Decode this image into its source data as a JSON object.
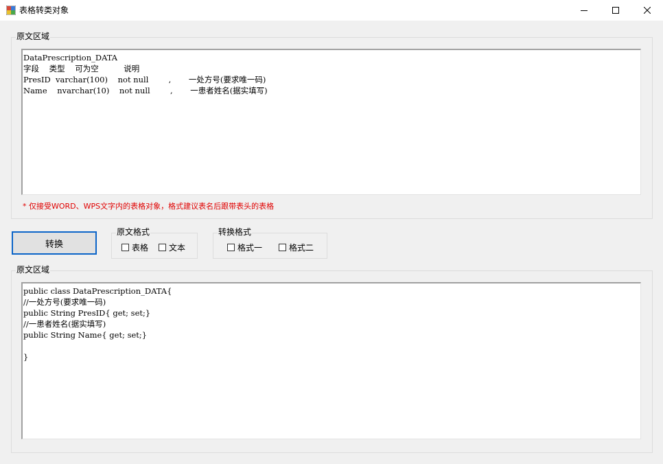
{
  "window": {
    "title": "表格转类对象",
    "minimize_icon": "minimize-icon",
    "maximize_icon": "maximize-icon",
    "close_icon": "close-icon"
  },
  "source_group": {
    "label": "原文区域",
    "text": "DataPrescription_DATA\n字段    类型    可为空          说明\nPresID  varchar(100)    not null        ,       一处方号(要求唯一码)\nName    nvarchar(10)    not null        ,       一患者姓名(据实填写)",
    "note": "* 仅接受WORD、WPS文字内的表格对象，格式建议表名后跟带表头的表格"
  },
  "convert_button": {
    "label": "转换"
  },
  "source_format": {
    "label": "原文格式",
    "options": [
      {
        "label": "表格",
        "checked": false
      },
      {
        "label": "文本",
        "checked": false
      }
    ]
  },
  "target_format": {
    "label": "转换格式",
    "options": [
      {
        "label": "格式一",
        "checked": false
      },
      {
        "label": "格式二",
        "checked": false
      }
    ]
  },
  "output_group": {
    "label": "原文区域",
    "text": "public class DataPrescription_DATA{\n//一处方号(要求唯一码)\npublic String PresID{ get; set;}\n//一患者姓名(据实填写)\npublic String Name{ get; set;}\n\n}"
  }
}
